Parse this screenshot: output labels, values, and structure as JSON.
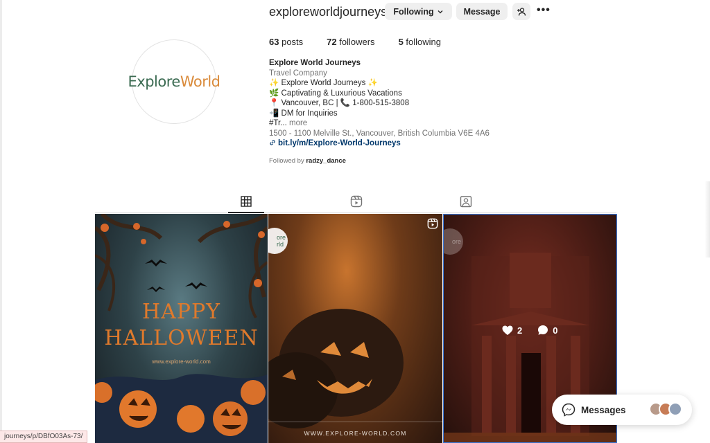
{
  "profile": {
    "username": "exploreworldjourneys",
    "avatar_logo": {
      "part1": "Explore",
      "part2": "World"
    },
    "buttons": {
      "following": "Following",
      "message": "Message"
    },
    "stats": {
      "posts_count": "63",
      "posts_label": "posts",
      "followers_count": "72",
      "followers_label": "followers",
      "following_count": "5",
      "following_label": "following"
    },
    "bio": {
      "name": "Explore World Journeys",
      "category": "Travel Company",
      "line1": "✨ Explore World Journeys ✨",
      "line2": "🌿 Captivating & Luxurious Vacations",
      "line3": "📍 Vancouver, BC | 📞 1-800-515-3808",
      "line4": "📲 DM for Inquiries",
      "line5": "#Tr...",
      "more": "more",
      "address": "1500 - 1100 Melville St., Vancouver, British Columbia V6E 4A6",
      "link": "bit.ly/m/Explore-World-Journeys"
    },
    "followed_by_prefix": "Followed by",
    "followed_by_user": "radzy_dance"
  },
  "tabs": [
    {
      "icon": "grid-icon",
      "active": true
    },
    {
      "icon": "reels-icon",
      "active": false
    },
    {
      "icon": "tagged-icon",
      "active": false
    }
  ],
  "posts": [
    {
      "title_line1": "HAPPY",
      "title_line2": "HALLOWEEN",
      "url": "www.explore-world.com"
    },
    {
      "url": "WWW.EXPLORE-WORLD.COM",
      "avatar_text": "ore\nrld"
    },
    {
      "likes": "2",
      "comments": "0"
    }
  ],
  "messages": {
    "label": "Messages"
  },
  "status_bar": {
    "url": "journeys/p/DBfO03As-73/"
  },
  "colors": {
    "accent_link": "#00376b",
    "button_bg": "#efefef",
    "selection_border": "#3a78d9"
  }
}
